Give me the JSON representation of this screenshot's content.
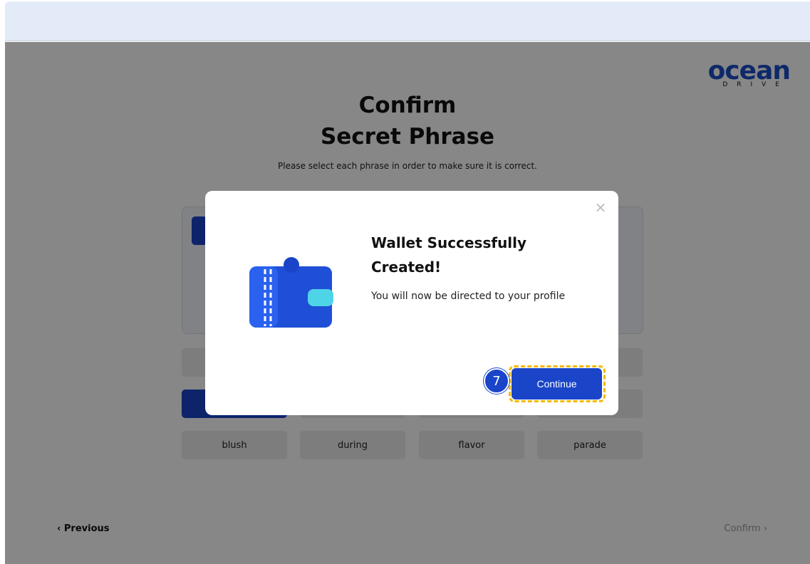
{
  "logo": {
    "text": "ocean",
    "sub": "DRIVE"
  },
  "header": {
    "title_line1": "Confirm",
    "title_line2": "Secret Phrase",
    "subtitle": "Please select each phrase in order to make sure it is correct."
  },
  "word_grid": {
    "row3": [
      "blush",
      "during",
      "flavor",
      "parade"
    ]
  },
  "nav": {
    "previous_label": "‹ Previous",
    "confirm_label": "Confirm ›"
  },
  "modal": {
    "close_icon": "×",
    "title": "Wallet Successfully Created!",
    "description": "You will now be directed to your profile",
    "continue_label": "Continue",
    "step_number": "7"
  },
  "colors": {
    "accent": "#1a45c9",
    "highlight": "#f5b800",
    "wallet_light": "#4fd3e6"
  }
}
